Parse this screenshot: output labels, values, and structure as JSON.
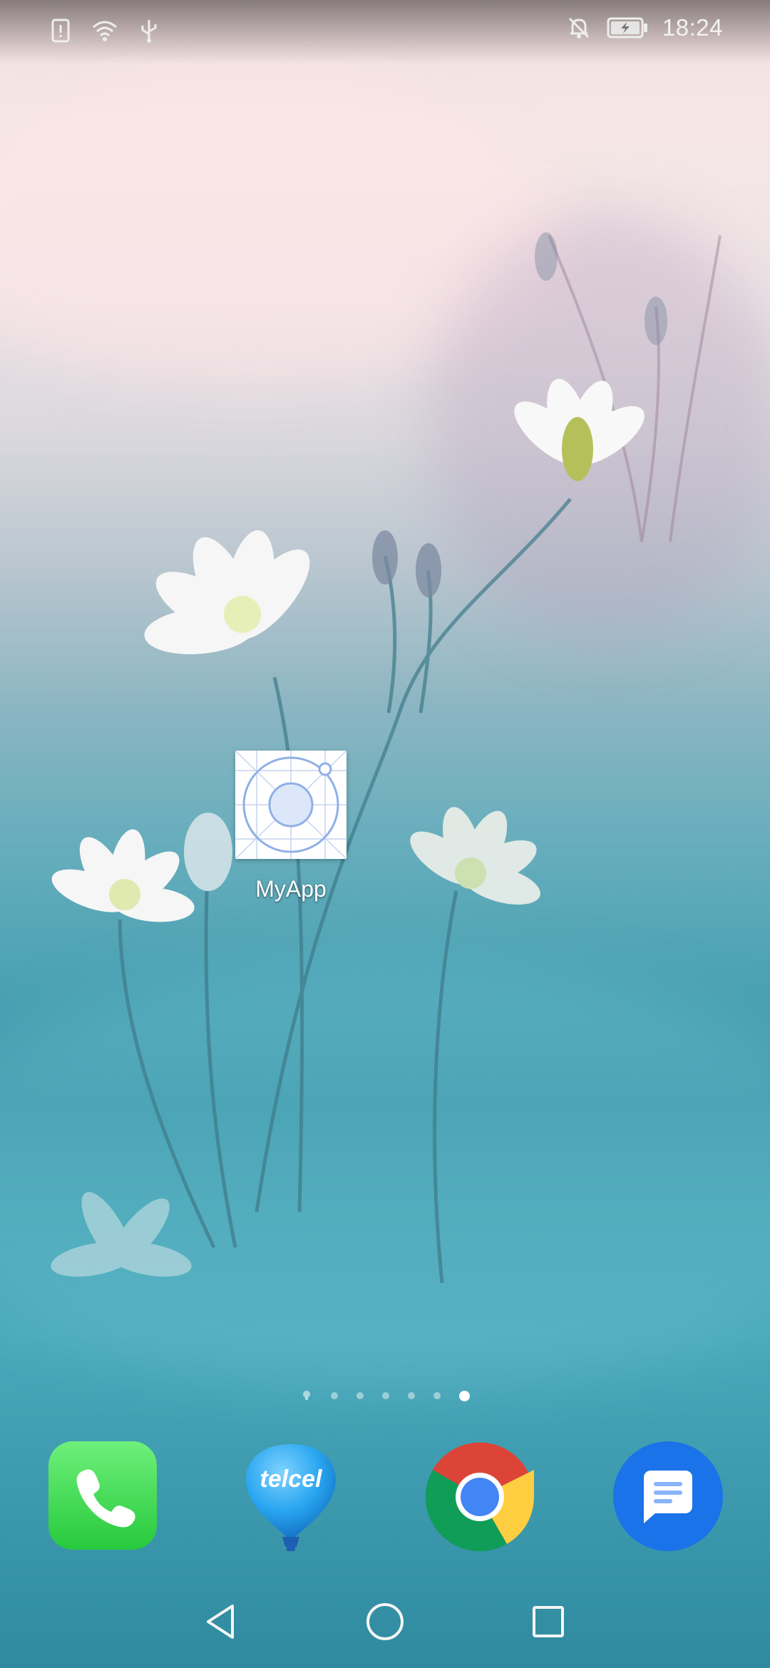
{
  "status_bar": {
    "left_icons": [
      "sim-alert-icon",
      "wifi-icon",
      "usb-icon"
    ],
    "right_icons": [
      "notifications-off-icon",
      "battery-charging-icon"
    ],
    "time": "18:24"
  },
  "home": {
    "apps": [
      {
        "label": "MyApp",
        "icon": "myapp-icon"
      }
    ],
    "page_indicator": {
      "pages": 7,
      "active_index": 6,
      "first_is_home": true
    }
  },
  "dock": {
    "items": [
      {
        "name": "Phone",
        "icon": "phone-icon"
      },
      {
        "name": "telcel",
        "icon": "telcel-icon",
        "text": "telcel"
      },
      {
        "name": "Chrome",
        "icon": "chrome-icon"
      },
      {
        "name": "Messages",
        "icon": "messages-icon"
      }
    ]
  },
  "nav_bar": {
    "buttons": [
      "back",
      "home",
      "recents"
    ]
  },
  "colors": {
    "phone_green": "#34d44a",
    "messages_blue": "#1a73e8",
    "telcel_blue": "#2aa6f0"
  }
}
